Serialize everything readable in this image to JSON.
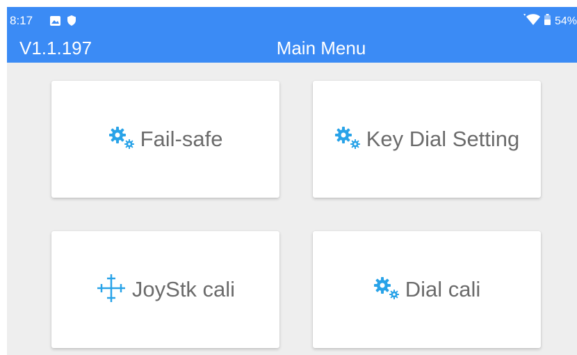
{
  "status_bar": {
    "time": "8:17",
    "battery": "54%",
    "icons": [
      "image-icon",
      "shield-icon",
      "wifi-icon",
      "battery-icon"
    ]
  },
  "app_bar": {
    "version": "V1.1.197",
    "title": "Main Menu",
    "color": "#3b8bf5"
  },
  "menu": {
    "items": [
      {
        "label": "Fail-safe",
        "icon": "gear-icon"
      },
      {
        "label": "Key Dial Setting",
        "icon": "gear-icon"
      },
      {
        "label": "JoyStk cali",
        "icon": "crosshair-icon"
      },
      {
        "label": "Dial cali",
        "icon": "gear-icon"
      }
    ],
    "icon_color": "#29a3e8",
    "label_color": "#6b6b6b"
  }
}
